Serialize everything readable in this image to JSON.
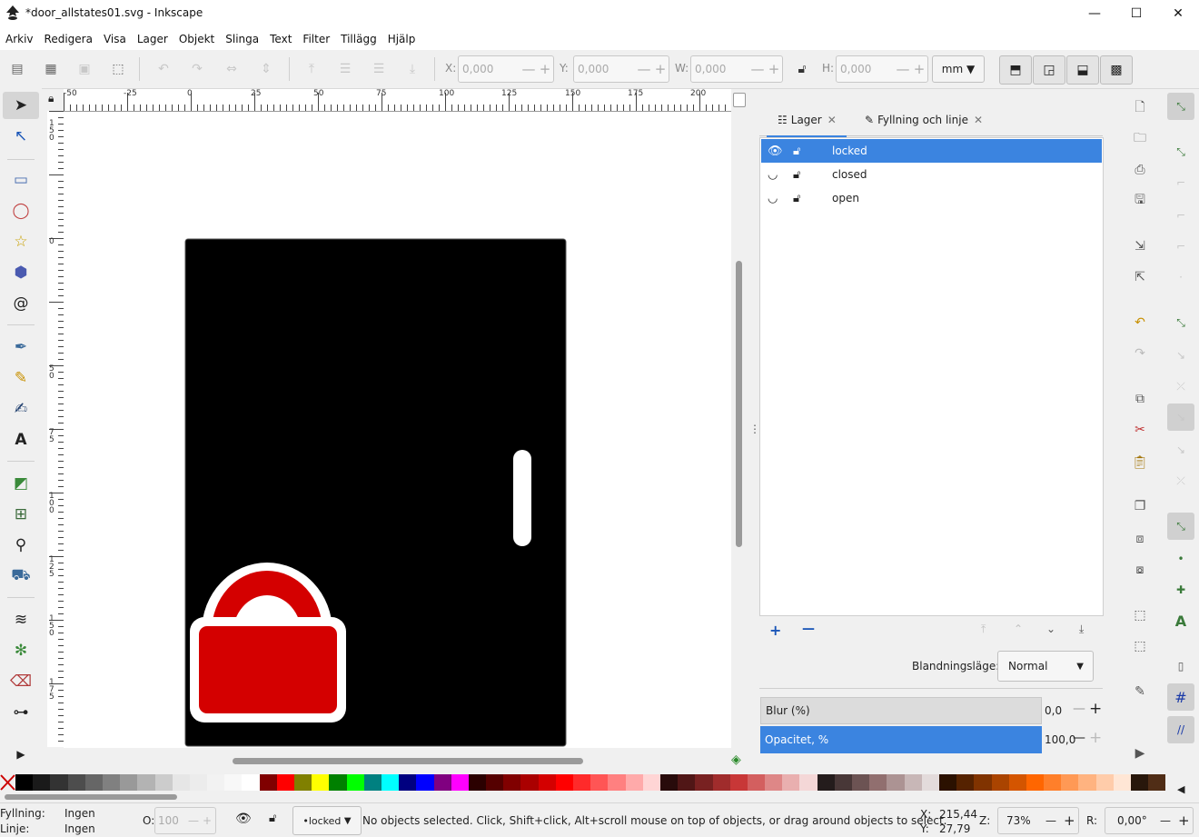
{
  "window": {
    "title": "*door_allstates01.svg - Inkscape",
    "minimize": "—",
    "maximize": "☐",
    "close": "✕"
  },
  "menu": [
    "Arkiv",
    "Redigera",
    "Visa",
    "Lager",
    "Objekt",
    "Slinga",
    "Text",
    "Filter",
    "Tillägg",
    "Hjälp"
  ],
  "toolbar": {
    "x_label": "X:",
    "x_value": "0,000",
    "y_label": "Y:",
    "y_value": "0,000",
    "w_label": "W:",
    "w_value": "0,000",
    "h_label": "H:",
    "h_value": "0,000",
    "unit": "mm",
    "minus": "—",
    "plus": "+"
  },
  "ruler": {
    "h_ticks": [
      "-50",
      "-25",
      "0",
      "25",
      "50",
      "75",
      "100",
      "125",
      "150",
      "175",
      "200"
    ],
    "v_ticks": [
      "1 5 0",
      "0",
      "5 0",
      "7 5",
      "1 0 0",
      "1 2 5",
      "1 5 0",
      "1 7 5"
    ]
  },
  "dock": {
    "tab_layers": "Lager",
    "tab_fill": "Fyllning och linje",
    "tab_close": "✕",
    "layers": [
      {
        "name": "locked",
        "selected": true
      },
      {
        "name": "closed",
        "selected": false
      },
      {
        "name": "open",
        "selected": false
      }
    ],
    "add": "+",
    "remove": "—",
    "blend_label": "Blandningsläge:",
    "blend_value": "Normal",
    "blur_label": "Blur (%)",
    "blur_value": "0,0",
    "opacity_label": "Opacitet, %",
    "opacity_value": "100,0"
  },
  "status": {
    "fill_label": "Fyllning:",
    "fill_value": "Ingen",
    "stroke_label": "Linje:",
    "stroke_value": "Ingen",
    "opacity_label": "O:",
    "opacity_value": "100",
    "layer": "•locked",
    "message": "No objects selected. Click, Shift+click, Alt+scroll mouse on top of objects, or drag around objects to select.",
    "x_label": "X:",
    "x_value": "215,44",
    "y_label": "Y:",
    "y_value": "27,79",
    "zoom_label": "Z:",
    "zoom_value": "73%",
    "rot_label": "R:",
    "rot_value": "0,00°"
  },
  "palette": [
    "#000000",
    "#1a1a1a",
    "#333333",
    "#4d4d4d",
    "#666666",
    "#808080",
    "#999999",
    "#b3b3b3",
    "#cccccc",
    "#e6e6e6",
    "#ececec",
    "#f2f2f2",
    "#f8f8f8",
    "#ffffff",
    "#800000",
    "#ff0000",
    "#808000",
    "#ffff00",
    "#008000",
    "#00ff00",
    "#008080",
    "#00ffff",
    "#000080",
    "#0000ff",
    "#800080",
    "#ff00ff",
    "#2b0000",
    "#550000",
    "#800000",
    "#aa0000",
    "#d40000",
    "#ff0000",
    "#ff2a2a",
    "#ff5555",
    "#ff8080",
    "#ffaaaa",
    "#ffd5d5",
    "#280b0b",
    "#501616",
    "#782121",
    "#a02c2c",
    "#c83737",
    "#d35f5f",
    "#de8787",
    "#e9afaf",
    "#f4d7d7",
    "#241c1c",
    "#483737",
    "#6c5353",
    "#916f6f",
    "#ac9393",
    "#c8b7b7",
    "#e3dbdb",
    "#2b1100",
    "#552200",
    "#803300",
    "#aa4400",
    "#d45500",
    "#ff6600",
    "#ff7f2a",
    "#ff9955",
    "#ffb380",
    "#ffccaa",
    "#ffe6d5",
    "#28170b",
    "#502d16"
  ],
  "colors": {
    "selection": "#3b84e0",
    "door": "#000000",
    "lock_red": "#d40000"
  }
}
